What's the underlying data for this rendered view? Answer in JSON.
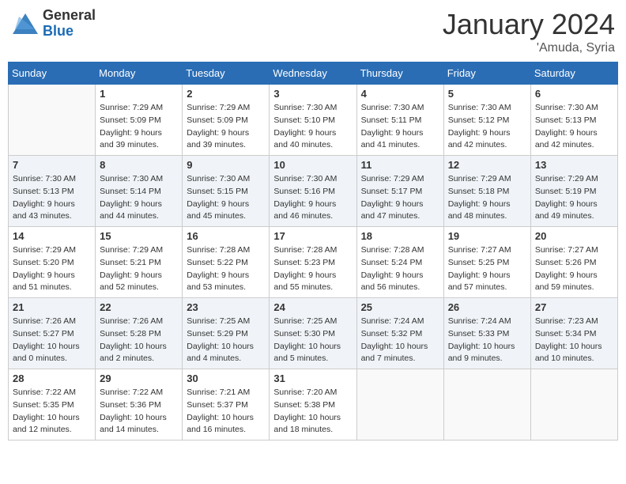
{
  "app": {
    "name_general": "General",
    "name_blue": "Blue"
  },
  "title": "January 2024",
  "location": "'Amuda, Syria",
  "weekdays": [
    "Sunday",
    "Monday",
    "Tuesday",
    "Wednesday",
    "Thursday",
    "Friday",
    "Saturday"
  ],
  "weeks": [
    [
      {
        "day": null
      },
      {
        "day": 1,
        "sunrise": "Sunrise: 7:29 AM",
        "sunset": "Sunset: 5:09 PM",
        "daylight": "Daylight: 9 hours and 39 minutes."
      },
      {
        "day": 2,
        "sunrise": "Sunrise: 7:29 AM",
        "sunset": "Sunset: 5:09 PM",
        "daylight": "Daylight: 9 hours and 39 minutes."
      },
      {
        "day": 3,
        "sunrise": "Sunrise: 7:30 AM",
        "sunset": "Sunset: 5:10 PM",
        "daylight": "Daylight: 9 hours and 40 minutes."
      },
      {
        "day": 4,
        "sunrise": "Sunrise: 7:30 AM",
        "sunset": "Sunset: 5:11 PM",
        "daylight": "Daylight: 9 hours and 41 minutes."
      },
      {
        "day": 5,
        "sunrise": "Sunrise: 7:30 AM",
        "sunset": "Sunset: 5:12 PM",
        "daylight": "Daylight: 9 hours and 42 minutes."
      },
      {
        "day": 6,
        "sunrise": "Sunrise: 7:30 AM",
        "sunset": "Sunset: 5:13 PM",
        "daylight": "Daylight: 9 hours and 42 minutes."
      }
    ],
    [
      {
        "day": 7,
        "sunrise": "Sunrise: 7:30 AM",
        "sunset": "Sunset: 5:13 PM",
        "daylight": "Daylight: 9 hours and 43 minutes."
      },
      {
        "day": 8,
        "sunrise": "Sunrise: 7:30 AM",
        "sunset": "Sunset: 5:14 PM",
        "daylight": "Daylight: 9 hours and 44 minutes."
      },
      {
        "day": 9,
        "sunrise": "Sunrise: 7:30 AM",
        "sunset": "Sunset: 5:15 PM",
        "daylight": "Daylight: 9 hours and 45 minutes."
      },
      {
        "day": 10,
        "sunrise": "Sunrise: 7:30 AM",
        "sunset": "Sunset: 5:16 PM",
        "daylight": "Daylight: 9 hours and 46 minutes."
      },
      {
        "day": 11,
        "sunrise": "Sunrise: 7:29 AM",
        "sunset": "Sunset: 5:17 PM",
        "daylight": "Daylight: 9 hours and 47 minutes."
      },
      {
        "day": 12,
        "sunrise": "Sunrise: 7:29 AM",
        "sunset": "Sunset: 5:18 PM",
        "daylight": "Daylight: 9 hours and 48 minutes."
      },
      {
        "day": 13,
        "sunrise": "Sunrise: 7:29 AM",
        "sunset": "Sunset: 5:19 PM",
        "daylight": "Daylight: 9 hours and 49 minutes."
      }
    ],
    [
      {
        "day": 14,
        "sunrise": "Sunrise: 7:29 AM",
        "sunset": "Sunset: 5:20 PM",
        "daylight": "Daylight: 9 hours and 51 minutes."
      },
      {
        "day": 15,
        "sunrise": "Sunrise: 7:29 AM",
        "sunset": "Sunset: 5:21 PM",
        "daylight": "Daylight: 9 hours and 52 minutes."
      },
      {
        "day": 16,
        "sunrise": "Sunrise: 7:28 AM",
        "sunset": "Sunset: 5:22 PM",
        "daylight": "Daylight: 9 hours and 53 minutes."
      },
      {
        "day": 17,
        "sunrise": "Sunrise: 7:28 AM",
        "sunset": "Sunset: 5:23 PM",
        "daylight": "Daylight: 9 hours and 55 minutes."
      },
      {
        "day": 18,
        "sunrise": "Sunrise: 7:28 AM",
        "sunset": "Sunset: 5:24 PM",
        "daylight": "Daylight: 9 hours and 56 minutes."
      },
      {
        "day": 19,
        "sunrise": "Sunrise: 7:27 AM",
        "sunset": "Sunset: 5:25 PM",
        "daylight": "Daylight: 9 hours and 57 minutes."
      },
      {
        "day": 20,
        "sunrise": "Sunrise: 7:27 AM",
        "sunset": "Sunset: 5:26 PM",
        "daylight": "Daylight: 9 hours and 59 minutes."
      }
    ],
    [
      {
        "day": 21,
        "sunrise": "Sunrise: 7:26 AM",
        "sunset": "Sunset: 5:27 PM",
        "daylight": "Daylight: 10 hours and 0 minutes."
      },
      {
        "day": 22,
        "sunrise": "Sunrise: 7:26 AM",
        "sunset": "Sunset: 5:28 PM",
        "daylight": "Daylight: 10 hours and 2 minutes."
      },
      {
        "day": 23,
        "sunrise": "Sunrise: 7:25 AM",
        "sunset": "Sunset: 5:29 PM",
        "daylight": "Daylight: 10 hours and 4 minutes."
      },
      {
        "day": 24,
        "sunrise": "Sunrise: 7:25 AM",
        "sunset": "Sunset: 5:30 PM",
        "daylight": "Daylight: 10 hours and 5 minutes."
      },
      {
        "day": 25,
        "sunrise": "Sunrise: 7:24 AM",
        "sunset": "Sunset: 5:32 PM",
        "daylight": "Daylight: 10 hours and 7 minutes."
      },
      {
        "day": 26,
        "sunrise": "Sunrise: 7:24 AM",
        "sunset": "Sunset: 5:33 PM",
        "daylight": "Daylight: 10 hours and 9 minutes."
      },
      {
        "day": 27,
        "sunrise": "Sunrise: 7:23 AM",
        "sunset": "Sunset: 5:34 PM",
        "daylight": "Daylight: 10 hours and 10 minutes."
      }
    ],
    [
      {
        "day": 28,
        "sunrise": "Sunrise: 7:22 AM",
        "sunset": "Sunset: 5:35 PM",
        "daylight": "Daylight: 10 hours and 12 minutes."
      },
      {
        "day": 29,
        "sunrise": "Sunrise: 7:22 AM",
        "sunset": "Sunset: 5:36 PM",
        "daylight": "Daylight: 10 hours and 14 minutes."
      },
      {
        "day": 30,
        "sunrise": "Sunrise: 7:21 AM",
        "sunset": "Sunset: 5:37 PM",
        "daylight": "Daylight: 10 hours and 16 minutes."
      },
      {
        "day": 31,
        "sunrise": "Sunrise: 7:20 AM",
        "sunset": "Sunset: 5:38 PM",
        "daylight": "Daylight: 10 hours and 18 minutes."
      },
      {
        "day": null
      },
      {
        "day": null
      },
      {
        "day": null
      }
    ]
  ]
}
